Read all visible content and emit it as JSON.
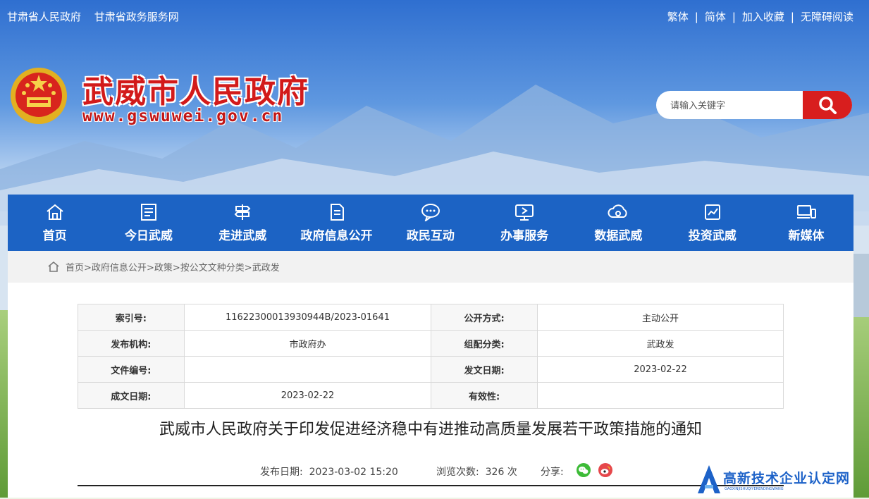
{
  "topbar": {
    "links_left": [
      "甘肃省人民政府",
      "甘肃省政务服务网"
    ],
    "links_right": [
      "繁体",
      "简体",
      "加入收藏",
      "无障碍阅读"
    ]
  },
  "header": {
    "title": "武威市人民政府",
    "url": "www.gswuwei.gov.cn"
  },
  "search": {
    "placeholder": "请输入关键字",
    "icon": "search-icon"
  },
  "nav": {
    "items": [
      {
        "label": "首页",
        "icon": "home-icon"
      },
      {
        "label": "今日武威",
        "icon": "newspaper-icon"
      },
      {
        "label": "走进武威",
        "icon": "signpost-icon"
      },
      {
        "label": "政府信息公开",
        "icon": "document-icon"
      },
      {
        "label": "政民互动",
        "icon": "chat-icon"
      },
      {
        "label": "办事服务",
        "icon": "monitor-icon"
      },
      {
        "label": "数据武威",
        "icon": "data-cloud-icon"
      },
      {
        "label": "投资武威",
        "icon": "chart-icon"
      },
      {
        "label": "新媒体",
        "icon": "devices-icon"
      }
    ],
    "background": "#1c63c4"
  },
  "breadcrumb": {
    "items": [
      "首页",
      "政府信息公开",
      "政策",
      "按公文文种分类",
      "武政发"
    ]
  },
  "meta": {
    "rows": [
      {
        "k1": "索引号:",
        "v1": "11622300013930944B/2023-01641",
        "k2": "公开方式:",
        "v2": "主动公开"
      },
      {
        "k1": "发布机构:",
        "v1": "市政府办",
        "k2": "组配分类:",
        "v2": "武政发"
      },
      {
        "k1": "文件编号:",
        "v1": "",
        "k2": "发文日期:",
        "v2": "2023-02-22"
      },
      {
        "k1": "成文日期:",
        "v1": "2023-02-22",
        "k2": "有效性:",
        "v2": ""
      }
    ]
  },
  "doc": {
    "title": "武威市人民政府关于印发促进经济稳中有进推动高质量发展若干政策措施的通知",
    "publish_label": "发布日期:",
    "publish_date": "2023-03-02 15:20",
    "views_label": "浏览次数:",
    "views_count": "326 次",
    "share_label": "分享:"
  },
  "watermark": {
    "text": "高新技术企业认定网",
    "sub": "GAOXINJISHUQIYERENDINGWANG"
  },
  "colors": {
    "brand_red": "#d21a1a",
    "nav_blue": "#1c63c4",
    "wechat_green": "#3dbb37",
    "weibo_red": "#e6474b"
  }
}
